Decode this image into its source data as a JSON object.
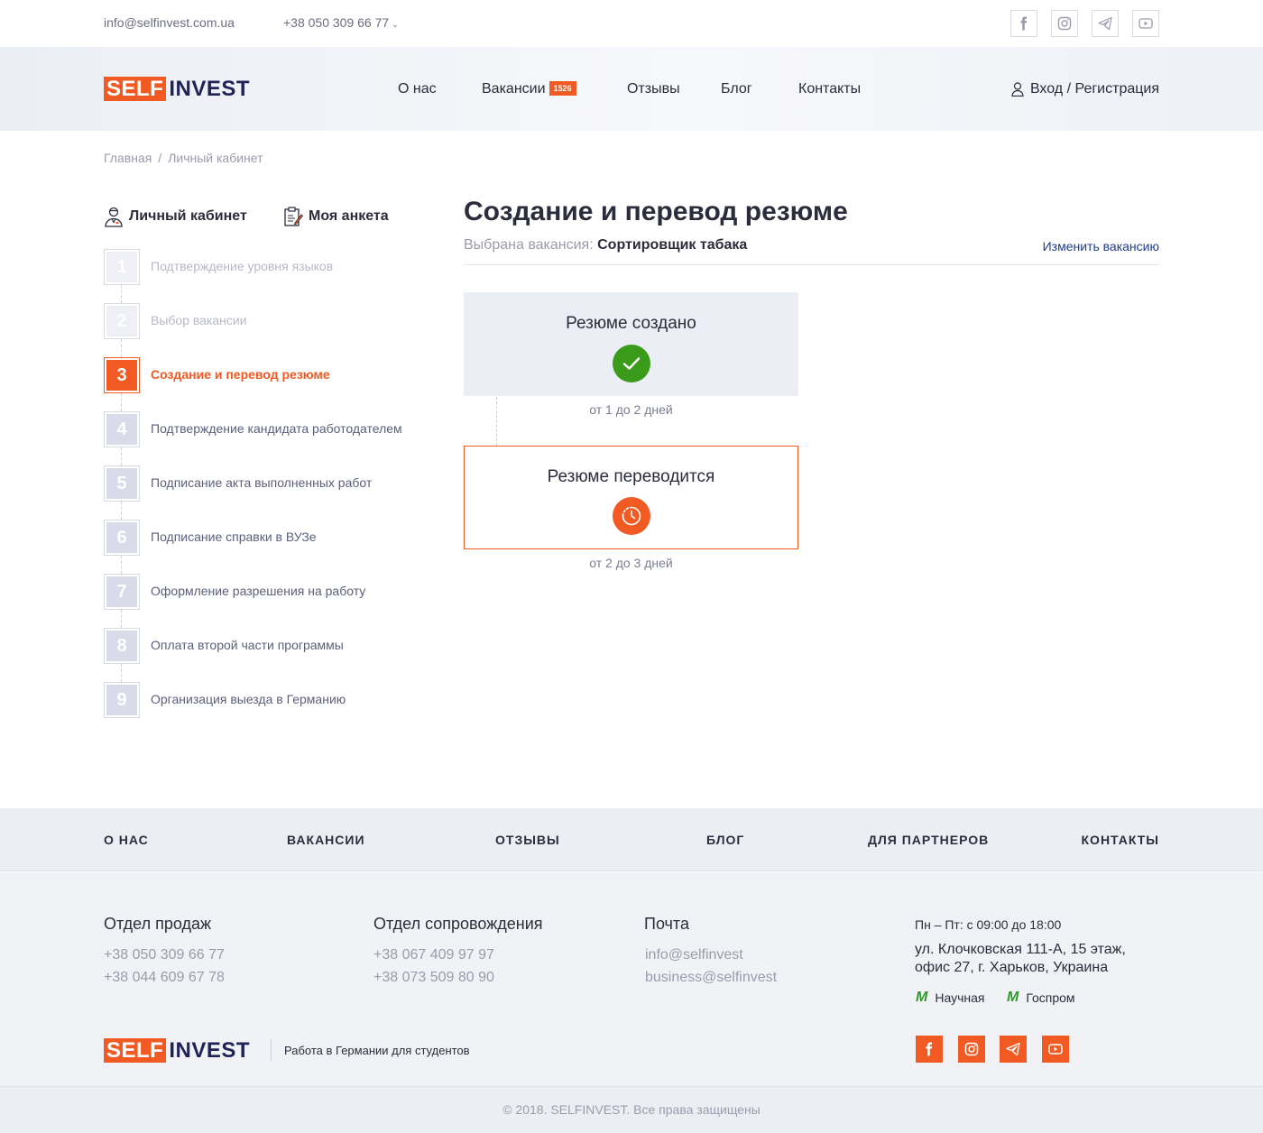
{
  "topbar": {
    "email": "info@selfinvest.com.ua",
    "phone": "+38 050 309 66 77",
    "social": [
      "facebook-icon",
      "instagram-icon",
      "telegram-icon",
      "youtube-icon"
    ]
  },
  "brand": {
    "self": "SELF",
    "invest": "INVEST",
    "accent": "#f15a22",
    "navy": "#1f2356"
  },
  "nav": {
    "items": [
      {
        "label": "О нас"
      },
      {
        "label": "Вакансии",
        "badge": "1526"
      },
      {
        "label": "Отзывы"
      },
      {
        "label": "Блог"
      },
      {
        "label": "Контакты"
      }
    ],
    "login": "Вход / Регистрация"
  },
  "breadcrumb": {
    "home": "Главная",
    "separator": "/",
    "current": "Личный кабинет"
  },
  "sidebar": {
    "tabs": [
      {
        "label": "Личный кабинет",
        "icon": "user-icon"
      },
      {
        "label": "Моя анкета",
        "icon": "clipboard-icon"
      }
    ],
    "steps": [
      {
        "num": "1",
        "label": "Подтверждение уровня языков",
        "state": "done"
      },
      {
        "num": "2",
        "label": "Выбор вакансии",
        "state": "done"
      },
      {
        "num": "3",
        "label": "Создание и перевод резюме",
        "state": "active"
      },
      {
        "num": "4",
        "label": "Подтверждение кандидата работодателем",
        "state": "pending"
      },
      {
        "num": "5",
        "label": "Подписание акта выполненных работ",
        "state": "pending"
      },
      {
        "num": "6",
        "label": "Подписание справки в ВУЗе",
        "state": "pending"
      },
      {
        "num": "7",
        "label": "Оформление разрешения на работу",
        "state": "pending"
      },
      {
        "num": "8",
        "label": "Оплата второй части программы",
        "state": "pending"
      },
      {
        "num": "9",
        "label": "Организация выезда в Германию",
        "state": "pending"
      }
    ]
  },
  "main": {
    "title": "Создание и перевод резюме",
    "vacancy_prefix": "Выбрана вакансия:",
    "vacancy_name": "Сортировщик табака",
    "change_link": "Изменить вакансию",
    "stages": [
      {
        "title": "Резюме создано",
        "status": "done",
        "icon": "check-icon",
        "duration": "от 1 до 2 дней"
      },
      {
        "title": "Резюме переводится",
        "status": "in-progress",
        "icon": "clock-icon",
        "duration": "от 2 до 3 дней"
      }
    ]
  },
  "footer_nav": [
    "О НАС",
    "ВАКАНСИИ",
    "ОТЗЫВЫ",
    "БЛОГ",
    "ДЛЯ ПАРТНЕРОВ",
    "КОНТАКТЫ"
  ],
  "footer": {
    "sales": {
      "title": "Отдел продаж",
      "phones": [
        "+38 050 309 66 77",
        "+38 044 609 67 78"
      ]
    },
    "support": {
      "title": "Отдел сопровождения",
      "phones": [
        "+38 067 409 97 97",
        "+38 073 509 80 90"
      ]
    },
    "mail": {
      "title": "Почта",
      "emails": [
        "info@selfinvest",
        "business@selfinvest"
      ]
    },
    "hours": "Пн – Пт: с 09:00 до 18:00",
    "address_line1": "ул. Клочковская 111-А, 15 этаж,",
    "address_line2": "офис 27, г. Харьков, Украина",
    "metro": [
      "Научная",
      "Госпром"
    ],
    "tagline": "Работа в Германии для студентов"
  },
  "copyright": "© 2018. SELFINVEST. Все права защищены"
}
